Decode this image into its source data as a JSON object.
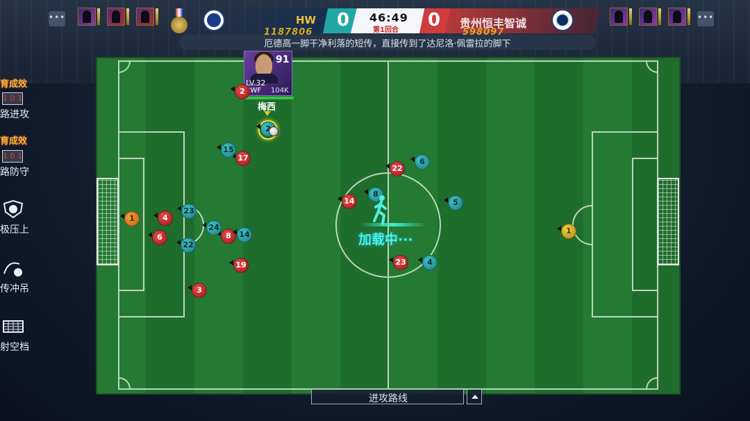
{
  "header": {
    "home_team": "HW",
    "home_score": "0",
    "away_score": "0",
    "clock": "46:49",
    "round": "第1回合",
    "away_team": "贵州恒丰智诚",
    "home_points": "1187806",
    "away_points": "598097",
    "menu_dots": "•••",
    "colors": {
      "home_score_bg": "#21a8a4",
      "away_score_bg": "#d23b3b",
      "points": "#d8a728"
    }
  },
  "commentary": "厄德高一脚干净利落的短传，直接传到了达尼洛·佩雷拉的脚下",
  "tactics_menu": [
    {
      "banner": "育成效",
      "formation": "1 0 1",
      "label": "路进攻"
    },
    {
      "banner": "育成效",
      "formation": "1 0 1",
      "label": "路防守"
    },
    {
      "label": "极压上",
      "icon": "shield-ball-icon"
    },
    {
      "label": "传冲吊",
      "icon": "cross-ball-icon"
    },
    {
      "label": "射空档",
      "icon": "goal-shot-icon"
    }
  ],
  "player_card": {
    "rating": "91",
    "level": "LV.32",
    "position": "RWF",
    "value": "104K",
    "name": "梅西",
    "stamina_fraction": 1.0
  },
  "home_players": [
    "2",
    "17",
    "22",
    "14",
    "4",
    "6",
    "8",
    "19",
    "3",
    "23"
  ],
  "away_players": [
    "15",
    "6",
    "8",
    "5",
    "23",
    "24",
    "22",
    "14",
    "4"
  ],
  "ball_carrier_number": "2",
  "goalkeepers": [
    "1",
    "1"
  ],
  "loading_text": "加载中···",
  "bottom": {
    "route_label": "进攻路线"
  }
}
